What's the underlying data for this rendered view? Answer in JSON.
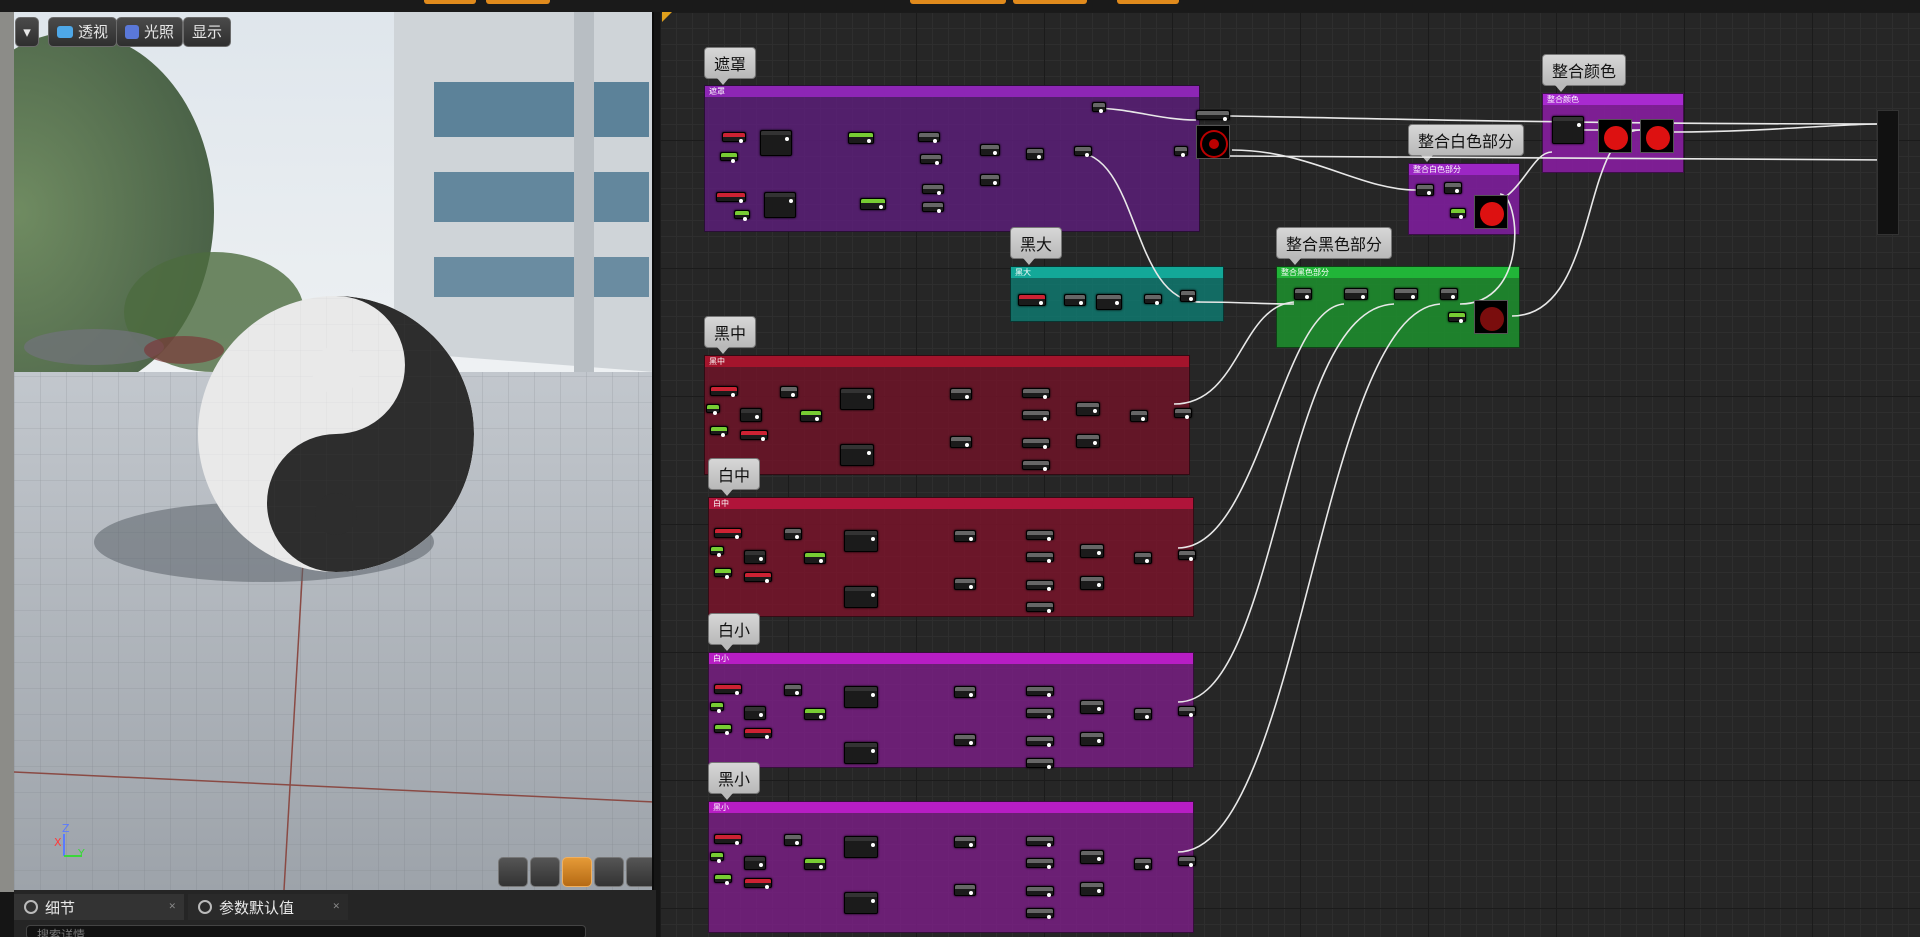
{
  "viewport": {
    "menu_label": "▾",
    "perspective_label": "透视",
    "lit_label": "光照",
    "show_label": "显示",
    "axis": {
      "z": "Z",
      "x": "X",
      "y": "Y"
    }
  },
  "panels": {
    "details_tab": "细节",
    "param_defaults_tab": "参数默认值",
    "search_placeholder": "搜索详情"
  },
  "graph": {
    "comments": [
      {
        "key": "mask",
        "title": "遮罩",
        "color": "#6b1f8c"
      },
      {
        "key": "black_large",
        "title": "黑大",
        "color": "#0f8a7e"
      },
      {
        "key": "black_mid",
        "title": "黑中",
        "color": "#6e1326"
      },
      {
        "key": "white_mid",
        "title": "白中",
        "color": "#7c1528"
      },
      {
        "key": "white_small",
        "title": "白小",
        "color": "#7a1d82"
      },
      {
        "key": "black_small",
        "title": "黑小",
        "color": "#7a1d82"
      },
      {
        "key": "merge_black",
        "title": "整合黑色部分",
        "color": "#1f8a2e"
      },
      {
        "key": "merge_white",
        "title": "整合白色部分",
        "color": "#7f1fa0"
      },
      {
        "key": "merge_color",
        "title": "整合颜色",
        "color": "#8a1fa2"
      }
    ]
  },
  "colors": {
    "accent": "#e08a1c",
    "preview_red": "#d11111"
  }
}
